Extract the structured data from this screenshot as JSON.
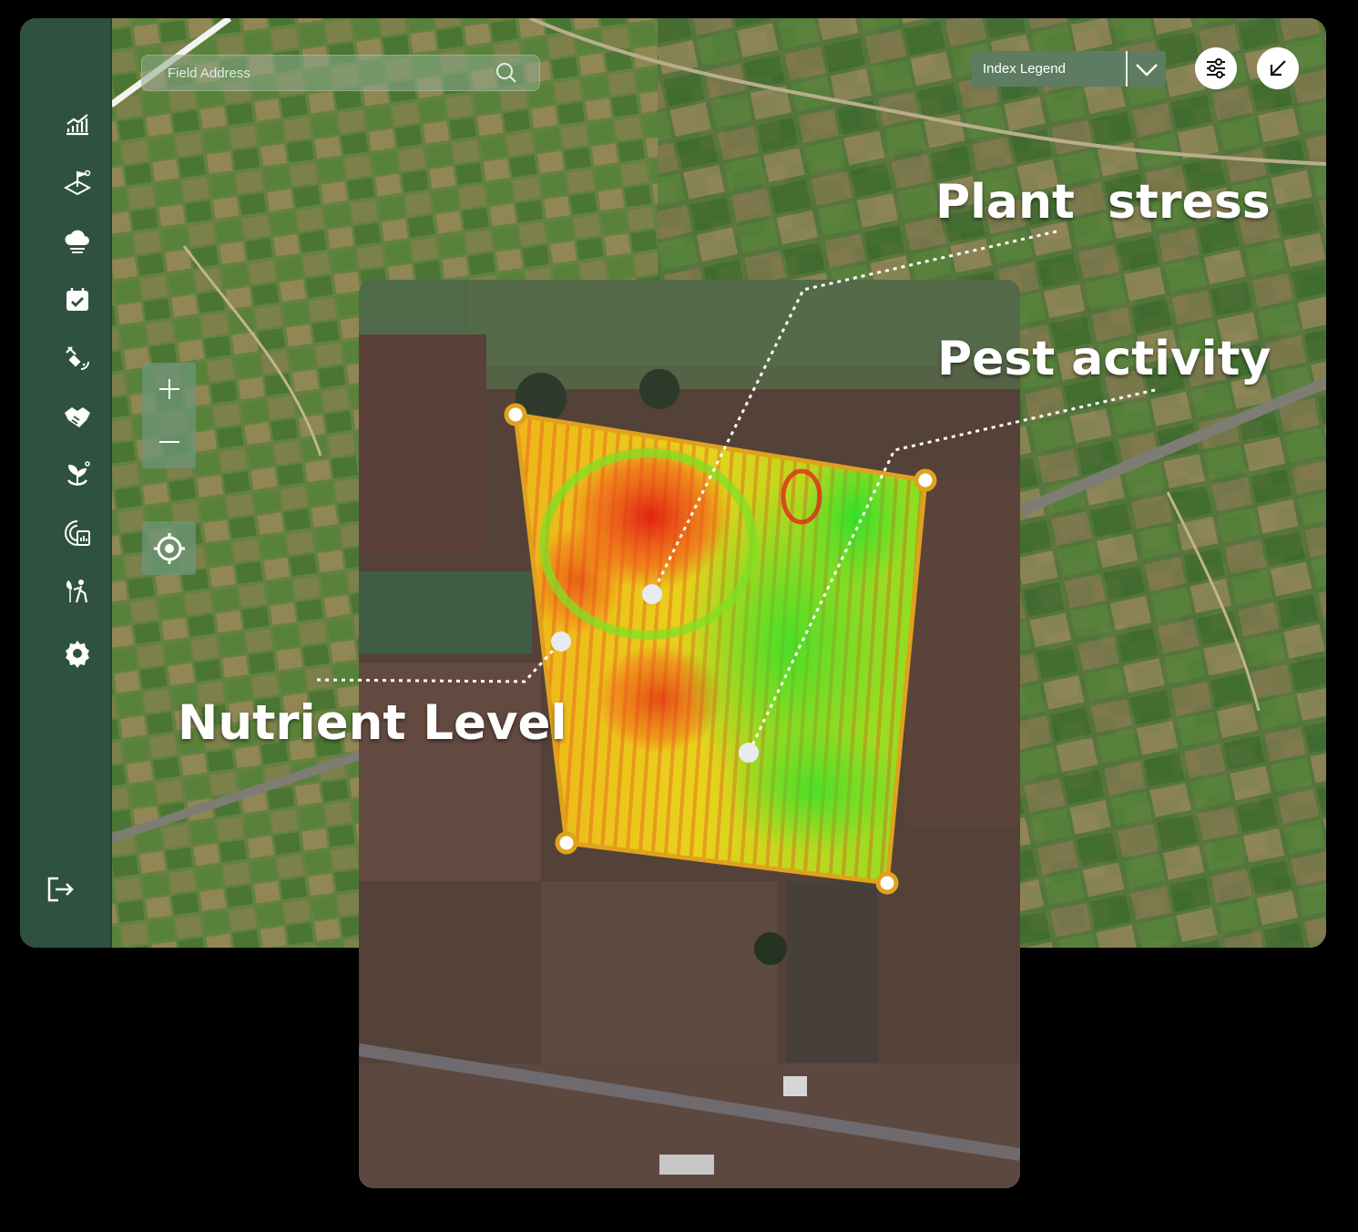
{
  "search": {
    "placeholder": "Field Address"
  },
  "index_legend": {
    "label": "Index Legend"
  },
  "sidebar": {
    "items": [
      {
        "icon": "analytics-chart-icon"
      },
      {
        "icon": "field-flag-icon"
      },
      {
        "icon": "weather-cloud-icon"
      },
      {
        "icon": "calendar-check-icon"
      },
      {
        "icon": "satellite-icon"
      },
      {
        "icon": "handshake-icon"
      },
      {
        "icon": "plant-growth-icon"
      },
      {
        "icon": "soil-report-icon"
      },
      {
        "icon": "farmer-scout-icon"
      },
      {
        "icon": "settings-gear-icon"
      }
    ],
    "logout_icon": "logout-icon"
  },
  "map_controls": {
    "zoom_in_icon": "plus-icon",
    "zoom_out_icon": "minus-icon",
    "locate_icon": "locate-target-icon"
  },
  "toolbar": {
    "filter_icon": "sliders-icon",
    "collapse_icon": "arrow-down-left-icon"
  },
  "callouts": {
    "plant_stress": "Plant  stress",
    "pest_activity": "Pest activity",
    "nutrient_level": "Nutrient Level"
  },
  "colors": {
    "sidebar": "#2f5140",
    "field_boundary": "#e0a21c",
    "high_stress": "#e02a1c",
    "healthy": "#3fe02a"
  }
}
